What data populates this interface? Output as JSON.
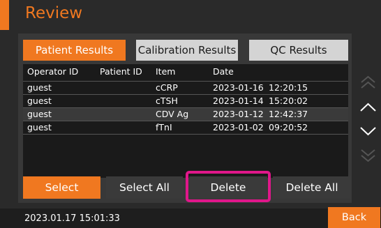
{
  "app": {
    "title": "Review"
  },
  "tabs": [
    {
      "label": "Patient Results",
      "active": true
    },
    {
      "label": "Calibration Results",
      "active": false
    },
    {
      "label": "QC Results",
      "active": false
    }
  ],
  "table": {
    "headers": [
      "Operator ID",
      "Patient ID",
      "Item",
      "Date"
    ],
    "rows": [
      {
        "operator": "guest",
        "patient": "",
        "item": "cCRP",
        "date": "2023-01-16",
        "time": "12:20:15"
      },
      {
        "operator": "guest",
        "patient": "",
        "item": "cTSH",
        "date": "2023-01-14",
        "time": "15:20:02"
      },
      {
        "operator": "guest",
        "patient": "",
        "item": "CDV Ag",
        "date": "2023-01-12",
        "time": "12:42:37"
      },
      {
        "operator": "guest",
        "patient": "",
        "item": "fTnI",
        "date": "2023-01-02",
        "time": "09:20:52"
      }
    ]
  },
  "actions": {
    "select": "Select",
    "select_all": "Select All",
    "delete": "Delete",
    "delete_all": "Delete All"
  },
  "footer": {
    "datetime": "2023.01.17 15:01:33",
    "back": "Back"
  },
  "nav": {
    "icons": [
      "double-chevron-up-icon",
      "chevron-up-icon",
      "chevron-down-icon",
      "double-chevron-down-icon"
    ]
  },
  "colors": {
    "accent": "#f07820",
    "highlight": "#e0178a",
    "background": "#2a2a2a"
  }
}
